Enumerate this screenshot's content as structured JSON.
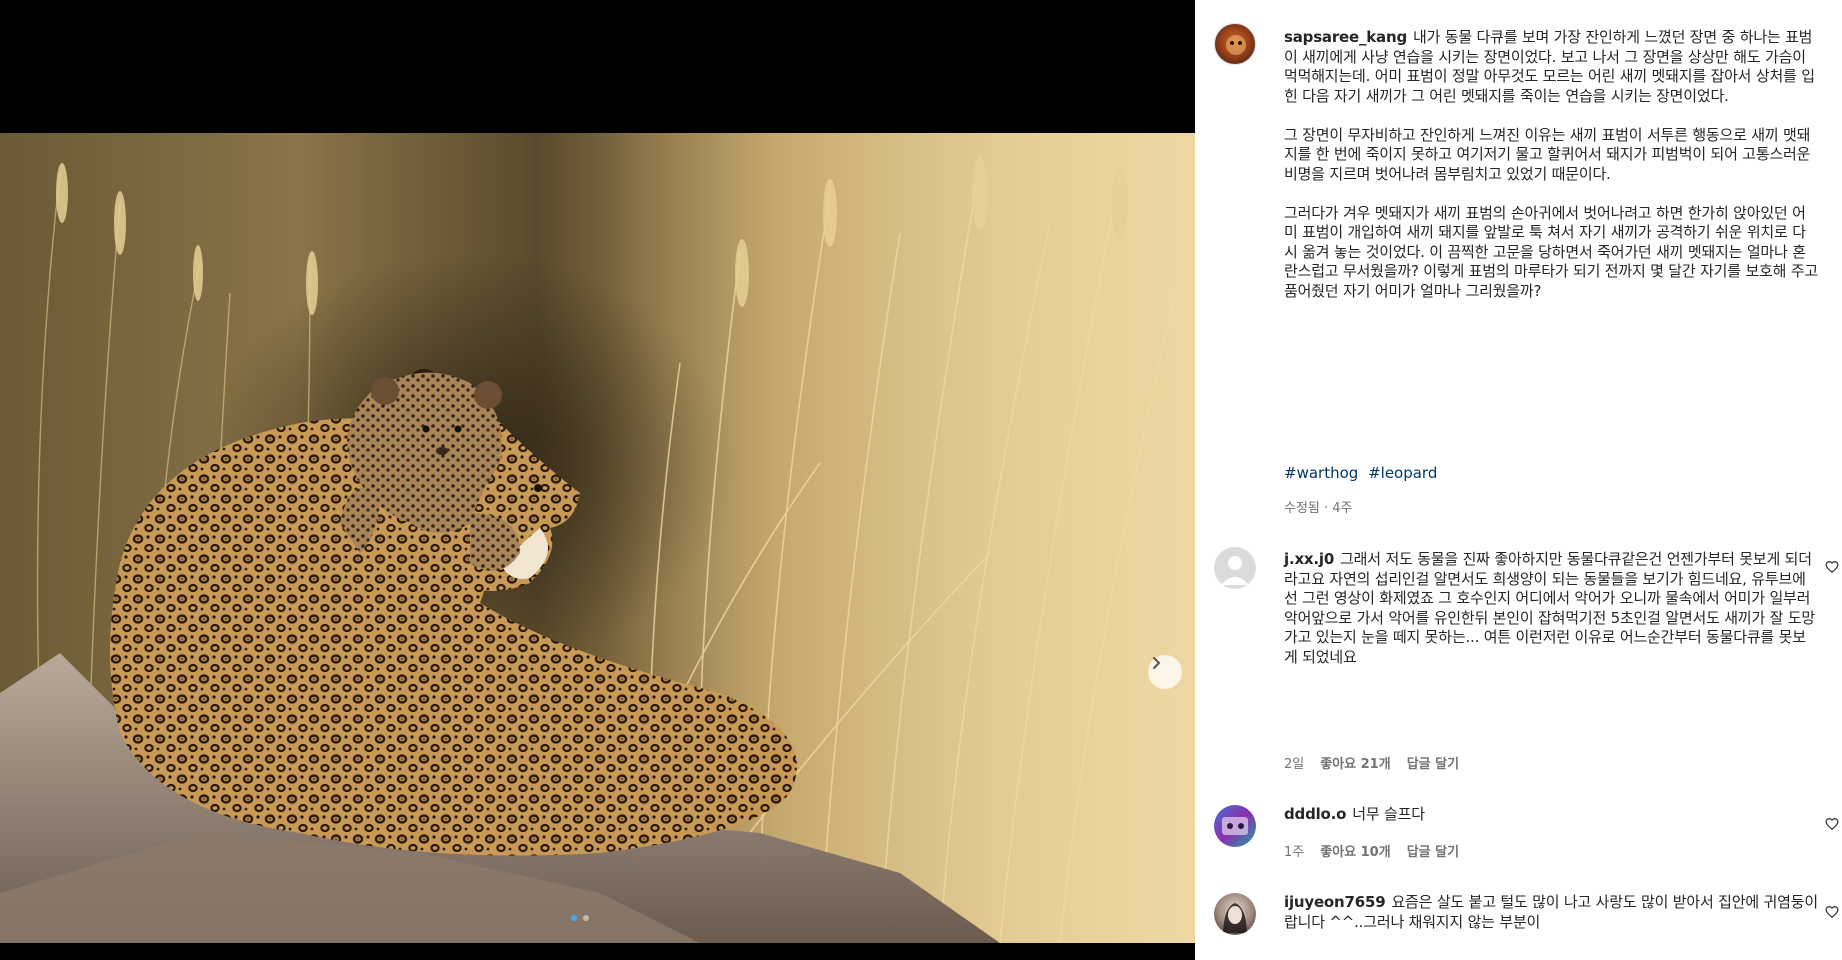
{
  "post": {
    "author": "sapsaree_kang",
    "caption_paragraphs": [
      "내가 동물 다큐를 보며 가장 잔인하게 느꼈던 장면 중 하나는 표범이 새끼에게 사냥 연습을 시키는 장면이었다. 보고 나서 그 장면을 상상만 해도 가슴이 먹먹해지는데. 어미 표범이 정말 아무것도 모르는 어린 새끼 멧돼지를 잡아서 상처를 입힌 다음 자기 새끼가 그 어린 멧돼지를 죽이는 연습을 시키는 장면이었다.",
      "그 장면이 무자비하고 잔인하게 느껴진 이유는 새끼 표범이 서투른 행동으로 새끼 맷돼지를 한 번에 죽이지 못하고 여기저기 물고 할퀴어서 돼지가 피범벅이 되어 고통스러운 비명을 지르며 벗어나려 몸부림치고 있었기 때문이다.",
      "그러다가 겨우 멧돼지가 새끼 표범의 손아귀에서 벗어나려고 하면 한가히 앉아있던 어미 표범이 개입하여 새끼 돼지를 앞발로 툭 쳐서 자기 새끼가 공격하기 쉬운 위치로 다시 옮겨 놓는 것이었다. 이 끔찍한 고문을 당하면서 죽어가던 새끼 멧돼지는 얼마나 혼란스럽고 무서웠을까? 이렇게 표범의 마루타가 되기 전까지 몇 달간 자기를 보호해 주고 품어줬던 자기 어미가 얼마나 그리웠을까?"
    ],
    "hashtags": [
      "#warthog",
      "#leopard"
    ],
    "meta": "수정됨 · 4주"
  },
  "comments": [
    {
      "username": "j.xx.j0",
      "text": "그래서 저도 동물을 진짜 좋아하지만 동물다큐같은건 언젠가부터 못보게 되더라고요 자연의 섭리인걸 알면서도 희생양이 되는 동물들을 보기가 힘드네요, 유투브에선 그런 영상이 화제였죠 그 호수인지 어디에서 악어가 오니까 물속에서 어미가 일부러 악어앞으로 가서 악어를 유인한뒤 본인이 잡혀먹기전 5초인걸 알면서도 새끼가 잘 도망가고 있는지 눈을 떼지 못하는... 여튼 이런저런 이유로 어느순간부터 동물다큐를 못보게 되었네요",
      "time": "2일",
      "likes": "좋아요 21개",
      "reply": "답글 달기"
    },
    {
      "username": "dddlo.o",
      "text": "너무 슬프다",
      "time": "1주",
      "likes": "좋아요 10개",
      "reply": "답글 달기"
    },
    {
      "username": "ijuyeon7659",
      "text": "요즘은 살도 붙고 털도 많이 나고 사랑도 많이 받아서 집안에 귀염둥이랍니다 ^^..그러나 채워지지 않는 부분이",
      "time": "",
      "likes": "",
      "reply": ""
    }
  ],
  "carousel": {
    "slide_count": 2,
    "active_index": 0
  },
  "colors": {
    "accent_blue": "#4aa6f5",
    "hashtag": "#00376b",
    "meta_gray": "#737373",
    "text": "#262626"
  },
  "icons": [
    "chevron-right-icon",
    "heart-icon",
    "avatar"
  ]
}
